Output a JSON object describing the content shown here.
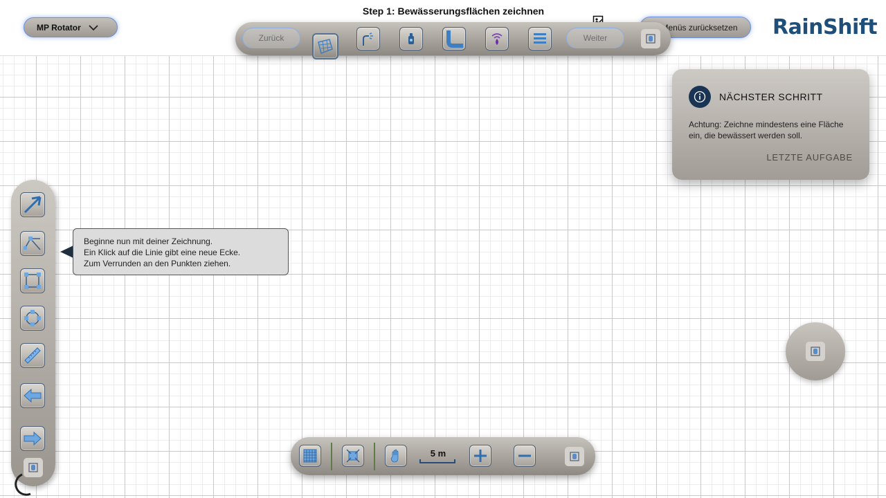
{
  "header": {
    "step_title": "Step 1: Bewässerungsflächen zeichnen",
    "product_select": "MP Rotator",
    "reset_label": "Menüs zurücksetzen",
    "logo": "RainShift"
  },
  "top_toolbar": {
    "back_label": "Zurück",
    "next_label": "Weiter",
    "tools": [
      "area-draw-icon",
      "sprinkler-icon",
      "valve-icon",
      "pipe-icon",
      "controller-icon",
      "list-icon"
    ]
  },
  "left_toolbar": {
    "tools": [
      "select-arrow-icon",
      "add-corner-icon",
      "rectangle-icon",
      "round-corners-icon",
      "measure-icon",
      "undo-arrow-icon",
      "redo-arrow-icon"
    ]
  },
  "hint": {
    "line1": "Beginne nun mit deiner Zeichnung.",
    "line2": "Ein Klick auf die Linie gibt eine neue Ecke.",
    "line3": "Zum Verrunden an den Punkten ziehen."
  },
  "info_panel": {
    "title": "NÄCHSTER SCHRITT",
    "text": "Achtung: Zeichne mindestens eine Fläche ein, die bewässert werden soll.",
    "link": "LETZTE AUFGABE"
  },
  "bottom_toolbar": {
    "scale": "5 m",
    "tools": [
      "grid-icon",
      "fit-view-icon",
      "pan-hand-icon",
      "zoom-in-icon",
      "zoom-out-icon"
    ]
  },
  "colors": {
    "accent": "#1d4f7a",
    "toolbar": "#a9a49d",
    "info_icon": "#193553"
  }
}
